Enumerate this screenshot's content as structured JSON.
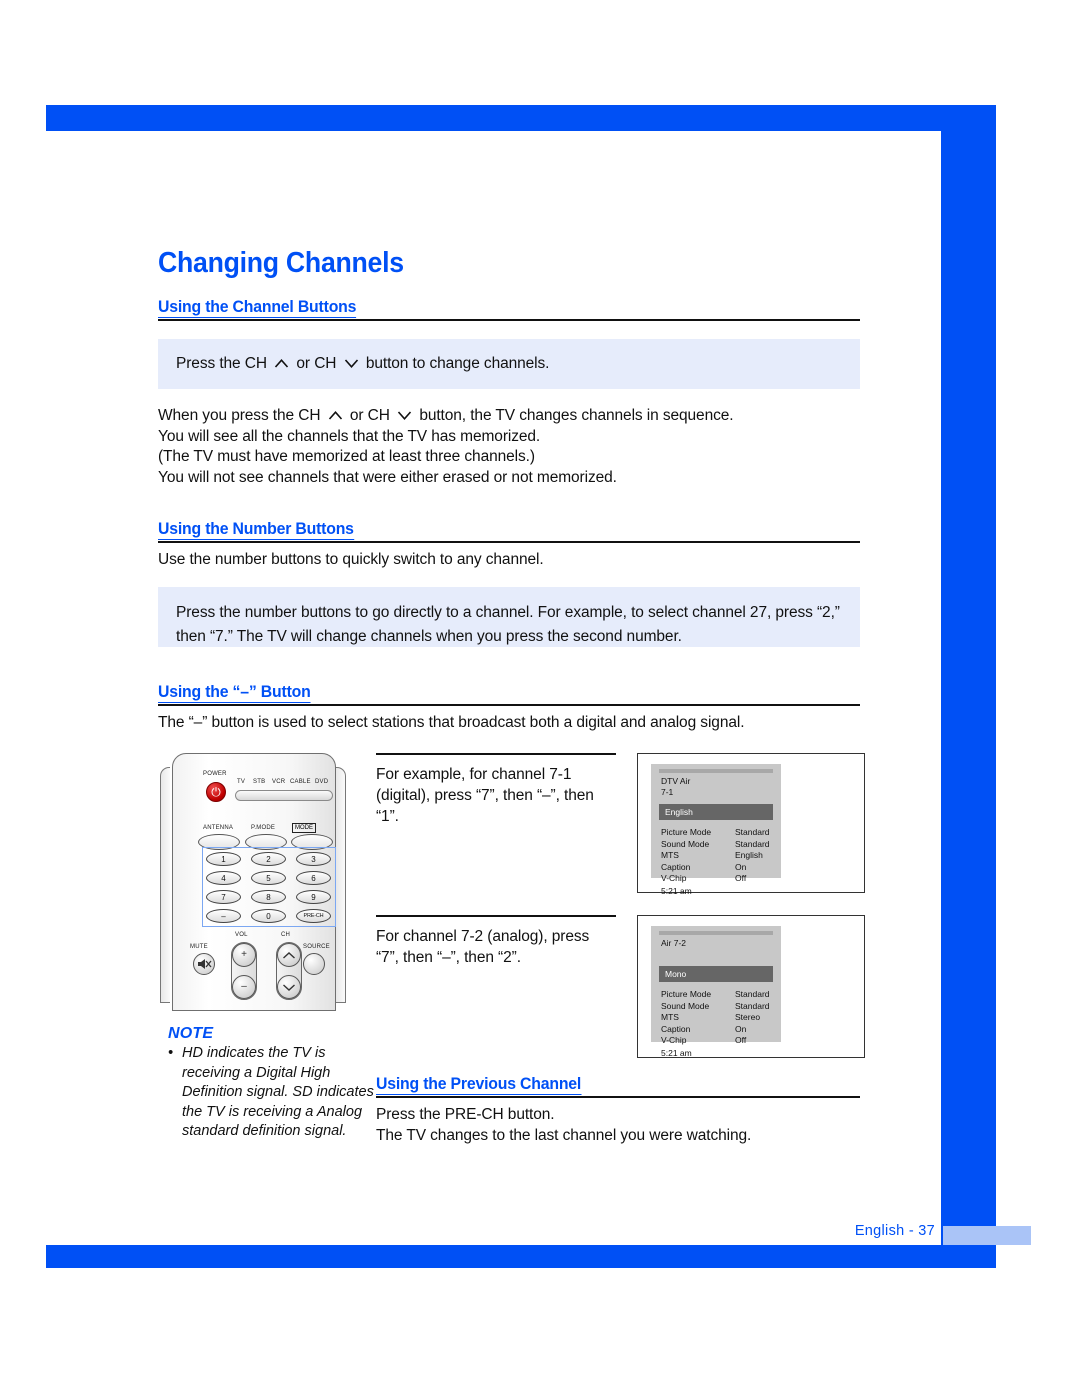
{
  "page": {
    "title": "Changing Channels",
    "footer_label": "English - 37",
    "accent_color": "#0050f5",
    "info_box_color": "#e6ecfb"
  },
  "sections": {
    "channel_buttons": {
      "heading": "Using the Channel Buttons",
      "info_box_pre": "Press the CH",
      "info_box_mid": "or CH",
      "info_box_post": "button to change channels.",
      "body_pre": "When you press the CH",
      "body_mid": "or CH",
      "body_post": "button, the TV changes channels in sequence.",
      "body_lines": [
        "You will see all the channels that the TV has memorized.",
        "(The TV must have memorized at least three channels.)",
        "You will not see channels that were either erased or not memorized."
      ]
    },
    "number_buttons": {
      "heading": "Using the Number Buttons",
      "lead": "Use the number buttons to quickly switch to any channel.",
      "info_box": "Press the number buttons to go directly to a channel. For example, to select channel 27, press “2,” then “7.” The TV will change channels when you press the second number."
    },
    "dash_button": {
      "heading": "Using the “–” Button",
      "lead": "The “–” button is used to select stations that broadcast both a digital and analog signal."
    },
    "previous_channel": {
      "heading": "Using the Previous Channel",
      "lines": [
        "Press the PRE-CH button.",
        "The TV changes to the last channel you were watching."
      ]
    }
  },
  "examples": [
    {
      "text": "For example, for channel 7-1 (digital), press “7”, then “–”, then “1”.",
      "osd": {
        "channel_line1": "DTV Air",
        "channel_line2": "7-1",
        "highlight": "English",
        "rows": [
          {
            "key": "Picture Mode",
            "value": "Standard"
          },
          {
            "key": "Sound Mode",
            "value": "Standard"
          },
          {
            "key": "MTS",
            "value": "English"
          },
          {
            "key": "Caption",
            "value": "On"
          },
          {
            "key": "V-Chip",
            "value": "Off"
          }
        ],
        "time": "5:21 am"
      }
    },
    {
      "text": "For channel 7-2 (analog), press “7”, then “–”, then “2”.",
      "osd": {
        "channel_line1": "Air 7-2",
        "channel_line2": "",
        "highlight": "Mono",
        "rows": [
          {
            "key": "Picture Mode",
            "value": "Standard"
          },
          {
            "key": "Sound Mode",
            "value": "Standard"
          },
          {
            "key": "MTS",
            "value": "Stereo"
          },
          {
            "key": "Caption",
            "value": "On"
          },
          {
            "key": "V-Chip",
            "value": "Off"
          }
        ],
        "time": "5:21 am"
      }
    }
  ],
  "note": {
    "title": "NOTE",
    "bullet": "•",
    "text": "HD indicates the TV is receiving a Digital High Definition signal. SD indicates the TV is receiving a Analog standard definition signal."
  },
  "remote": {
    "power_label": "POWER",
    "mode_labels": [
      "TV",
      "STB",
      "VCR",
      "CABLE",
      "DVD"
    ],
    "row3": [
      "ANTENNA",
      "P.MODE",
      "MODE"
    ],
    "numpad": [
      "1",
      "2",
      "3",
      "4",
      "5",
      "6",
      "7",
      "8",
      "9",
      "–",
      "0",
      "PRE-CH"
    ],
    "mute_label": "MUTE",
    "vol_label": "VOL",
    "ch_label": "CH",
    "source_label": "SOURCE",
    "vol_up": "+",
    "vol_down": "–"
  }
}
